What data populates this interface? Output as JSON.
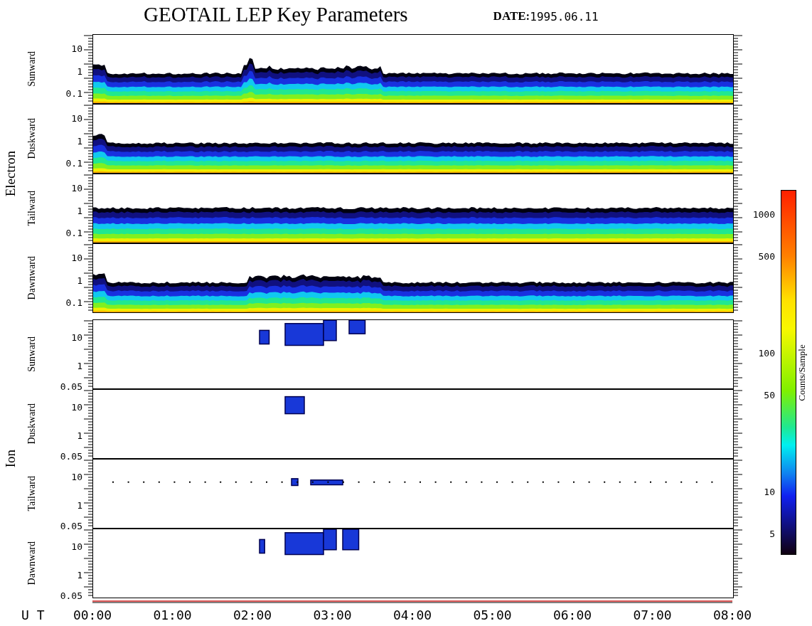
{
  "title": "GEOTAIL LEP Key Parameters",
  "date_label": "DATE:",
  "date": "1995.06.11",
  "groups": [
    {
      "label": "Electron",
      "kind": "electron",
      "panels": [
        {
          "label": "Sunward",
          "yticks": [
            "10",
            "1",
            "0.1"
          ]
        },
        {
          "label": "Duskward",
          "yticks": [
            "10",
            "1",
            "0.1"
          ]
        },
        {
          "label": "Tailward",
          "yticks": [
            "10",
            "1",
            "0.1"
          ]
        },
        {
          "label": "Dawnward",
          "yticks": [
            "10",
            "1",
            "0.1"
          ]
        }
      ]
    },
    {
      "label": "Ion",
      "kind": "ion",
      "panels": [
        {
          "label": "Sunward",
          "yticks": [
            "10",
            "1",
            "0.05"
          ]
        },
        {
          "label": "Duskward",
          "yticks": [
            "10",
            "1",
            "0.05"
          ]
        },
        {
          "label": "Tailward",
          "yticks": [
            "10",
            "1",
            "0.05"
          ]
        },
        {
          "label": "Dawnward",
          "yticks": [
            "10",
            "1",
            "0.05"
          ]
        }
      ]
    }
  ],
  "time_axis": {
    "label": "U T",
    "ticks": [
      "00:00",
      "01:00",
      "02:00",
      "03:00",
      "04:00",
      "05:00",
      "06:00",
      "07:00",
      "08:00"
    ]
  },
  "colorbar": {
    "label": "Counts/Sample",
    "ticks": [
      "1000",
      "500",
      "100",
      "50",
      "10",
      "5"
    ]
  }
}
